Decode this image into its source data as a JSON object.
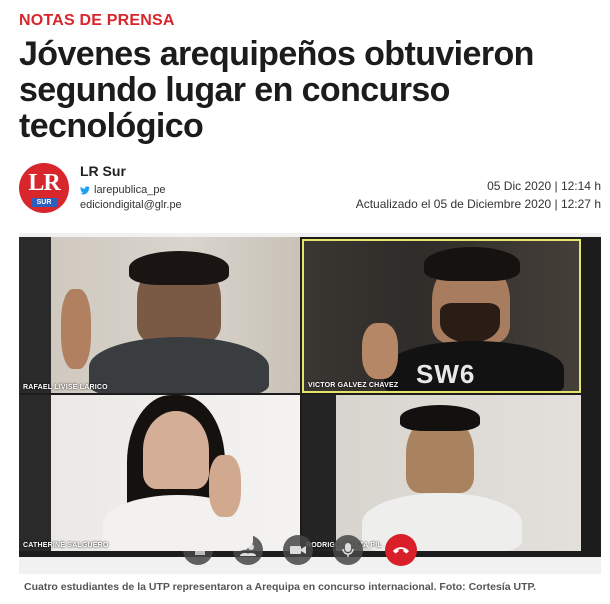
{
  "article": {
    "kicker": "NOTAS DE PRENSA",
    "headline": "Jóvenes arequipeños obtuvieron segundo lugar en concurso tecnológico",
    "author": {
      "logo_text": "LR",
      "logo_sub": "SUR",
      "name": "LR Sur",
      "twitter": "larepublica_pe",
      "email": "ediciondigital@glr.pe"
    },
    "published": "05 Dic 2020 | 12:14 h",
    "updated": "Actualizado el 05 de Diciembre 2020 | 12:27 h",
    "photo": {
      "participants": [
        "RAFAEL LIVISE LARICO",
        "VICTOR GALVEZ CHAVEZ",
        "CATHERINE SALGUERO",
        "RODRIGO CHAZA PIL"
      ],
      "shirt_text": "SW6",
      "controls": [
        "chat-icon",
        "participants-icon",
        "camera-icon",
        "microphone-icon",
        "hang-up-icon"
      ]
    },
    "caption": "Cuatro estudiantes de la UTP representaron a Arequipa en concurso internacional. Foto: Cortesía UTP."
  },
  "colors": {
    "accent": "#d7262c",
    "twitter": "#1da1f2",
    "active_speaker_border": "#e6e36a",
    "hang_up": "#d9202a"
  }
}
